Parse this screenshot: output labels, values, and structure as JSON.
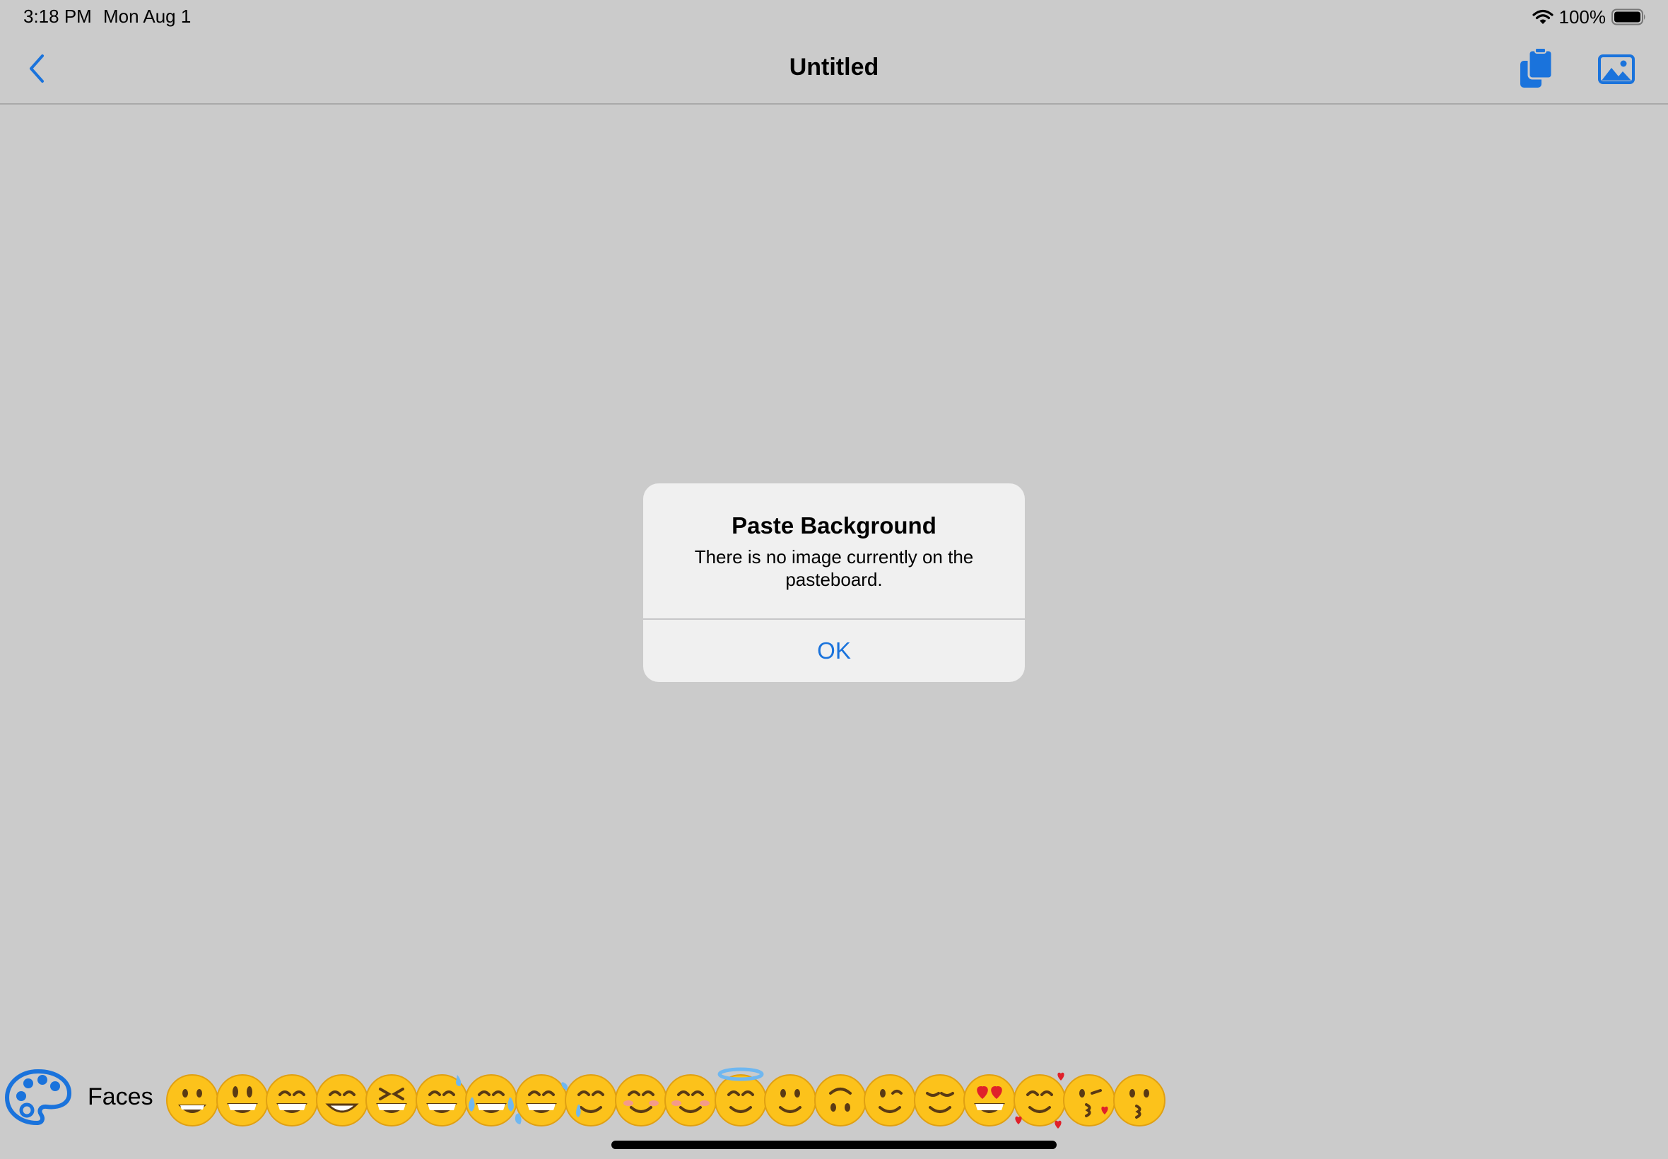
{
  "status_bar": {
    "time": "3:18 PM",
    "date": "Mon Aug 1",
    "battery_percent": "100%",
    "wifi_icon": "wifi-icon",
    "battery_icon": "battery-full-icon"
  },
  "nav_bar": {
    "title": "Untitled",
    "back_icon": "chevron-left-icon",
    "paste_icon": "paste-background-icon",
    "image_icon": "photo-icon"
  },
  "alert": {
    "title": "Paste Background",
    "message": "There is no image currently on the pasteboard.",
    "ok_label": "OK"
  },
  "emoji_toolbar": {
    "palette_icon": "palette-icon",
    "category_label": "Faces",
    "emojis": [
      "grinning-face",
      "grinning-face-big-eyes",
      "grinning-face-smiling-eyes",
      "beaming-face",
      "grinning-squinting-face",
      "grinning-face-sweat",
      "face-tears-of-joy",
      "rolling-on-floor-laughing",
      "smiling-face-tear",
      "smiling-face",
      "smiling-face-smiling-eyes",
      "smiling-face-halo",
      "slightly-smiling-face",
      "upside-down-face",
      "winking-face",
      "relieved-face",
      "smiling-face-heart-eyes",
      "smiling-face-hearts",
      "face-blowing-kiss",
      "kissing-face"
    ]
  },
  "colors": {
    "background": "#cbcbcb",
    "accent": "#1a73dc",
    "alert_background": "#f0f0f0",
    "emoji_yellow": "#fcc21b"
  }
}
